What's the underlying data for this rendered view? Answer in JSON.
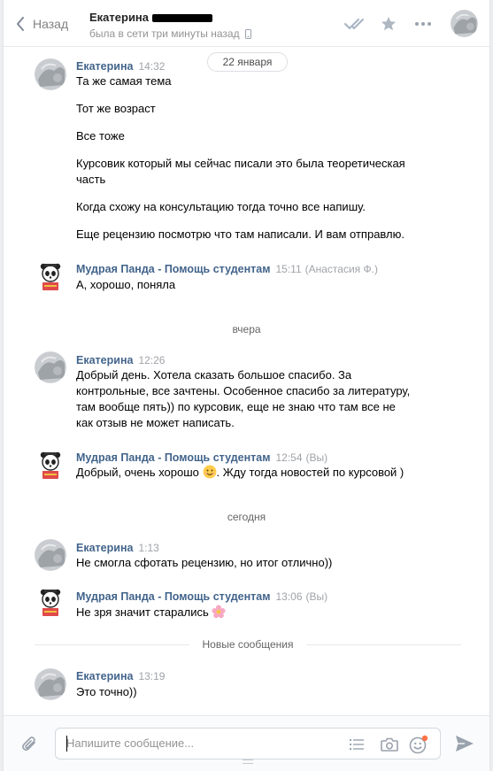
{
  "header": {
    "back_label": "Назад",
    "contact_name": "Екатерина",
    "status": "была в сети три минуты назад"
  },
  "date_pill": "22 января",
  "dividers": {
    "yesterday": "вчера",
    "today": "сегодня",
    "new_messages": "Новые сообщения"
  },
  "messages": [
    {
      "author": "Екатерина",
      "time": "14:32",
      "lines": [
        "Та же самая тема",
        "Тот же возраст",
        "Все тоже",
        "Курсовик который мы сейчас писали это была теоретическая",
        "часть",
        "Когда схожу на консультацию тогда точно все напишу.",
        "Еще рецензию посмотрю что там написали. И вам отправлю."
      ]
    },
    {
      "author": "Мудрая Панда - Помощь студентам",
      "time": "15:11",
      "sender_note": "(Анастасия Ф.)",
      "lines": [
        "А, хорошо, поняла"
      ]
    },
    {
      "author": "Екатерина",
      "time": "12:26",
      "lines": [
        "Добрый день. Хотела сказать большое спасибо. За",
        "контрольные, все зачтены. Особенное спасибо за литературу,",
        "там вообще пять)) по курсовик, еще не знаю что там все не",
        "как отзыв не может написать."
      ]
    },
    {
      "author": "Мудрая Панда - Помощь студентам",
      "time": "12:54",
      "sender_note": "(Вы)",
      "line_before_emoji": "Добрый, очень хорошо",
      "line_after_emoji": ". Жду тогда новостей по курсовой )"
    },
    {
      "author": "Екатерина",
      "time": "1:13",
      "lines": [
        "Не смогла сфотать рецензию, но итог отлично))"
      ]
    },
    {
      "author": "Мудрая Панда - Помощь студентам",
      "time": "13:06",
      "sender_note": "(Вы)",
      "line_before_emoji": "Не зря значит старались"
    },
    {
      "author": "Екатерина",
      "time": "13:19",
      "lines": [
        "Это точно))"
      ]
    }
  ],
  "composer": {
    "placeholder": "Напишите сообщение..."
  },
  "colors": {
    "author_link": "#42648b",
    "accent": "#5181b8"
  }
}
